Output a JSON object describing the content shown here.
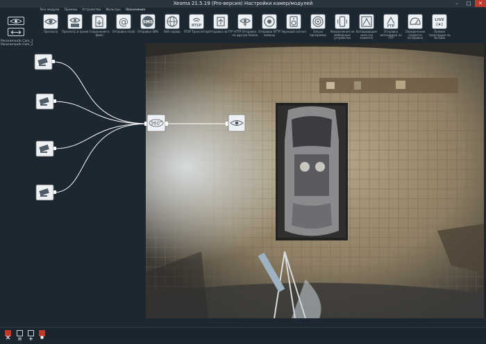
{
  "window": {
    "title": "Xeoma 21.5.19 (Pro-версия) Настройки камер/модулей",
    "controls": {
      "minimize": "–",
      "maximize": "□",
      "close": "✕"
    }
  },
  "menubar": {
    "items": [
      {
        "label": "Все модули",
        "active": false
      },
      {
        "label": "Приемы",
        "active": false
      },
      {
        "label": "Устройства",
        "active": false
      },
      {
        "label": "Фильтры",
        "active": false
      },
      {
        "label": "Назначения",
        "active": true
      }
    ]
  },
  "toolbar": {
    "items": [
      {
        "label": "Просмотр",
        "icon": "eye-icon"
      },
      {
        "label": "Просмотр и архив",
        "icon": "archive-icon"
      },
      {
        "label": "Сохранение в файл",
        "icon": "file-save-icon"
      },
      {
        "label": "Отправка email",
        "icon": "at-icon",
        "glyph": "@"
      },
      {
        "label": "Отправка SMS",
        "icon": "sms-icon",
        "glyph": "SMS"
      },
      {
        "label": "Веб-сервер",
        "icon": "globe-icon"
      },
      {
        "label": "RTSP Транслятор",
        "icon": "rtsp-icon",
        "glyph": "RTSP"
      },
      {
        "label": "Отправка на FTP",
        "icon": "ftp-upload-icon"
      },
      {
        "label": "HTTP Отправка на другую Xeoma",
        "icon": "http-upload-icon"
      },
      {
        "label": "Отправка HTTP команд",
        "icon": "http-command-icon"
      },
      {
        "label": "Звуковой сигнал",
        "icon": "speaker-icon"
      },
      {
        "label": "Запуск программы",
        "icon": "target-icon"
      },
      {
        "label": "Уведомления на мобильные устройства",
        "icon": "mobile-icon"
      },
      {
        "label": "Всплывающее окно (на клиенте)",
        "icon": "popup-icon"
      },
      {
        "label": "Отправка автономера на FTP",
        "icon": "ftp-icon",
        "glyph": "FTP"
      },
      {
        "label": "Определение скорости (отправка)",
        "icon": "speed-icon"
      },
      {
        "label": "Прямая трансляция на YouTube",
        "icon": "live-icon",
        "glyph": "LIVE"
      }
    ]
  },
  "cameras": [
    {
      "label": "Panoramaufo Cam_1"
    },
    {
      "label": "Panoramaufo Cam_2"
    }
  ],
  "graph": {
    "nodes": [
      {
        "id": "cam1",
        "icon": "camera-icon"
      },
      {
        "id": "cam2",
        "icon": "camera-icon"
      },
      {
        "id": "cam3",
        "icon": "camera-icon"
      },
      {
        "id": "cam4",
        "icon": "camera-icon"
      },
      {
        "id": "unwarp",
        "icon": "unwarp-360-icon",
        "label": "360°"
      },
      {
        "id": "view",
        "icon": "eye-icon"
      }
    ]
  },
  "bottombar": {
    "buttons": [
      {
        "icon": "delete-icon",
        "color": "#c0392b"
      },
      {
        "icon": "list-icon",
        "color": "#cfd8df"
      },
      {
        "icon": "add-icon",
        "color": "#cfd8df"
      },
      {
        "icon": "stop-icon",
        "color": "#c0392b"
      }
    ]
  },
  "colors": {
    "background": "#1c2731",
    "accent": "#c0392b",
    "node_fill": "#eef1f3",
    "link": "#ffffff"
  }
}
